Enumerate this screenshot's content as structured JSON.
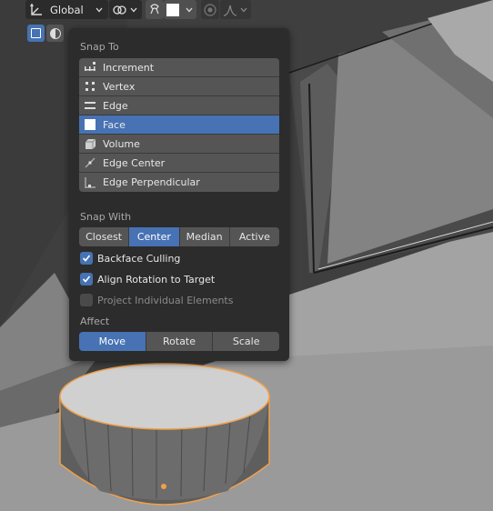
{
  "header": {
    "orientation_label": "Global",
    "orientation_icon": "transform-orientation-icon",
    "pivot_icon": "pivot-point-icon",
    "snap_toggle_icon": "magnet-snap-icon",
    "snap_element_icon": "face-snap-icon",
    "proportional_icon": "proportional-editing-icon",
    "falloff_icon": "falloff-curve-icon"
  },
  "toolbar": {
    "select_box_icon": "select-box-icon",
    "overlay_icon": "viewport-shading-icon"
  },
  "snap_popover": {
    "snap_to_label": "Snap To",
    "snap_to_items": [
      {
        "label": "Increment",
        "icon": "increment-icon"
      },
      {
        "label": "Vertex",
        "icon": "vertex-icon"
      },
      {
        "label": "Edge",
        "icon": "edge-icon"
      },
      {
        "label": "Face",
        "icon": "face-icon",
        "selected": true
      },
      {
        "label": "Volume",
        "icon": "volume-icon"
      },
      {
        "label": "Edge Center",
        "icon": "edge-center-icon"
      },
      {
        "label": "Edge Perpendicular",
        "icon": "edge-perpendicular-icon"
      }
    ],
    "snap_with_label": "Snap With",
    "snap_with_options": [
      "Closest",
      "Center",
      "Median",
      "Active"
    ],
    "snap_with_selected": "Center",
    "checkboxes": [
      {
        "label": "Backface Culling",
        "checked": true,
        "enabled": true
      },
      {
        "label": "Align Rotation to Target",
        "checked": true,
        "enabled": true
      },
      {
        "label": "Project Individual Elements",
        "checked": false,
        "enabled": false
      }
    ],
    "affect_label": "Affect",
    "affect_options": [
      "Move",
      "Rotate",
      "Scale"
    ],
    "affect_selected": "Move"
  },
  "colors": {
    "accent": "#4772b3",
    "panel_bg": "#2c2c2c",
    "item_bg": "#555555",
    "selection_outline": "#f0a04b"
  }
}
